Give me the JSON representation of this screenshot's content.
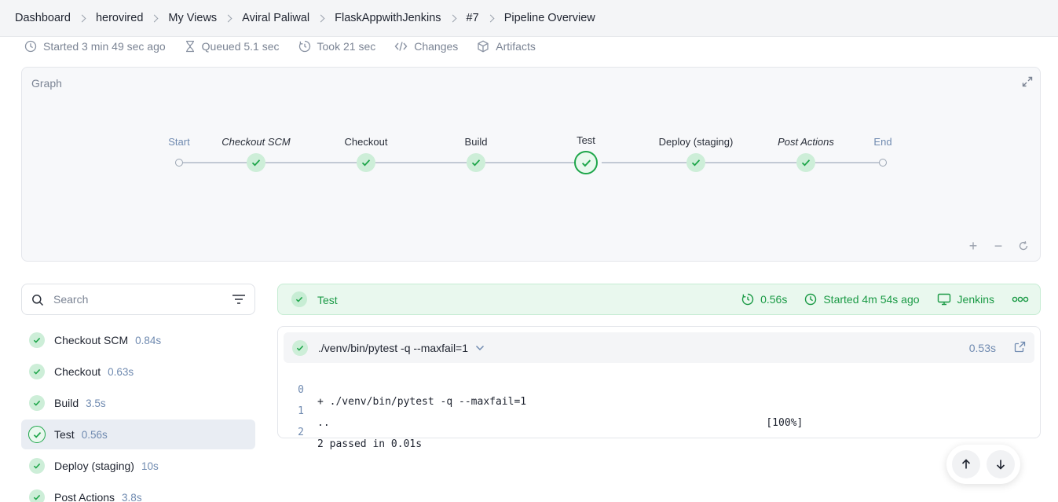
{
  "breadcrumb": [
    "Dashboard",
    "herovired",
    "My Views",
    "Aviral Paliwal",
    "FlaskAppwithJenkins",
    "#7",
    "Pipeline Overview"
  ],
  "meta": {
    "started": "Started 3 min 49 sec ago",
    "queued": "Queued 5.1 sec",
    "took": "Took 21 sec",
    "changes": "Changes",
    "artifacts": "Artifacts"
  },
  "graph": {
    "title": "Graph",
    "stages": [
      {
        "label": "Start",
        "kind": "start"
      },
      {
        "label": "Checkout SCM",
        "kind": "success",
        "italic": true
      },
      {
        "label": "Checkout",
        "kind": "success"
      },
      {
        "label": "Build",
        "kind": "success"
      },
      {
        "label": "Test",
        "kind": "success",
        "selected": true
      },
      {
        "label": "Deploy (staging)",
        "kind": "success"
      },
      {
        "label": "Post Actions",
        "kind": "success",
        "italic": true
      },
      {
        "label": "End",
        "kind": "end"
      }
    ],
    "zoom_in": "+",
    "zoom_out": "−"
  },
  "search": {
    "placeholder": "Search",
    "value": ""
  },
  "steps": [
    {
      "name": "Checkout SCM",
      "duration": "0.84s"
    },
    {
      "name": "Checkout",
      "duration": "0.63s"
    },
    {
      "name": "Build",
      "duration": "3.5s"
    },
    {
      "name": "Test",
      "duration": "0.56s",
      "active": true
    },
    {
      "name": "Deploy (staging)",
      "duration": "10s"
    },
    {
      "name": "Post Actions",
      "duration": "3.8s"
    }
  ],
  "stage_header": {
    "title": "Test",
    "duration": "0.56s",
    "started": "Started 4m 54s ago",
    "agent": "Jenkins"
  },
  "log": {
    "command": "./venv/bin/pytest -q --maxfail=1",
    "duration": "0.53s",
    "lines": [
      {
        "n": "0",
        "text": "+ ./venv/bin/pytest -q --maxfail=1"
      },
      {
        "n": "1",
        "text": "..                                                                       [100%]"
      },
      {
        "n": "2",
        "text": "2 passed in 0.01s"
      }
    ]
  },
  "colors": {
    "success": "#1ea64a",
    "success_bg": "#e9f8ee",
    "muted": "#6f8ab0"
  }
}
